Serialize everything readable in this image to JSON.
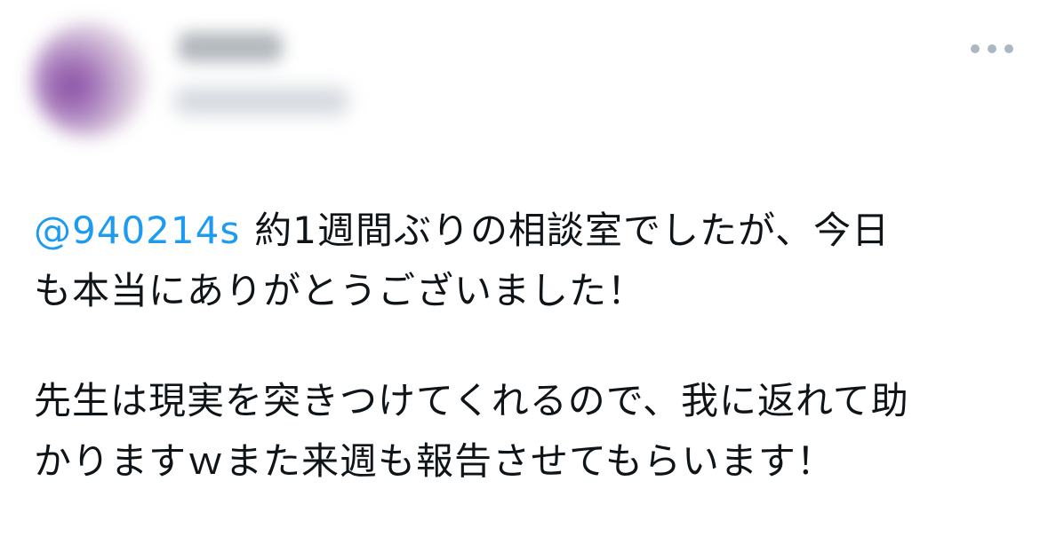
{
  "tweet": {
    "mention": "@940214s",
    "paragraph1": {
      "line1_rest": "約1週間ぶりの相談室でしたが、今日",
      "line2": "も本当にありがとうございました！"
    },
    "paragraph2": {
      "line1": "先生は現実を突きつけてくれるので、我に返れて助",
      "line2": "かりますｗまた来週も報告させてもらいます！"
    }
  },
  "icons": {
    "more": "more-horizontal-icon"
  },
  "colors": {
    "mention": "#1d9bf0",
    "text": "#0f1419",
    "more_dots": "#aab8c2"
  }
}
